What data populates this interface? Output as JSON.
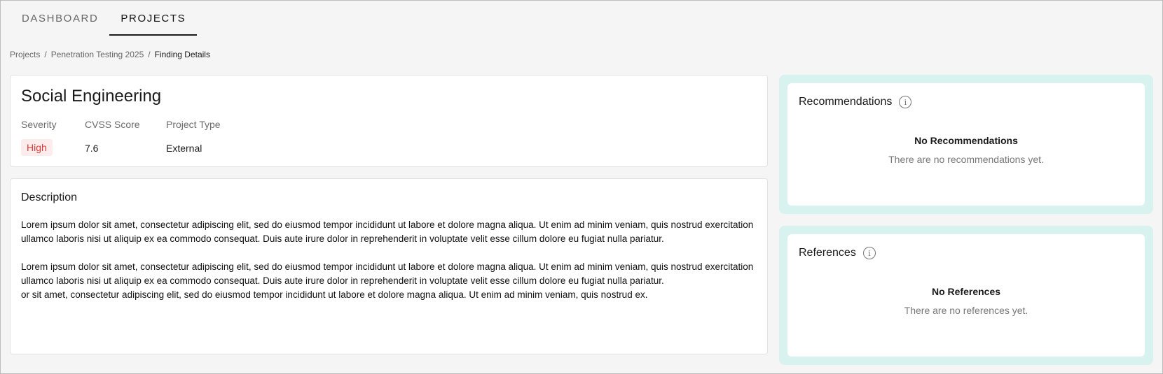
{
  "tabs": [
    {
      "label": "DASHBOARD",
      "active": false
    },
    {
      "label": "PROJECTS",
      "active": true
    }
  ],
  "breadcrumb": {
    "items": [
      "Projects",
      "Penetration Testing 2025"
    ],
    "current": "Finding Details",
    "separator": "/"
  },
  "finding": {
    "title": "Social Engineering",
    "severity_label": "Severity",
    "severity_value": "High",
    "cvss_label": "CVSS Score",
    "cvss_value": "7.6",
    "project_type_label": "Project Type",
    "project_type_value": "External",
    "severity_color": "#d93b3b"
  },
  "description": {
    "title": "Description",
    "paragraphs": [
      "Lorem ipsum dolor sit amet, consectetur adipiscing elit, sed do eiusmod tempor incididunt ut labore et dolore magna aliqua. Ut enim ad minim veniam, quis nostrud exercitation ullamco laboris nisi ut aliquip ex ea commodo consequat. Duis aute irure dolor in reprehenderit in voluptate velit esse cillum dolore eu fugiat nulla pariatur.",
      "Lorem ipsum dolor sit amet, consectetur adipiscing elit, sed do eiusmod tempor incididunt ut labore et dolore magna aliqua. Ut enim ad minim veniam, quis nostrud exercitation ullamco laboris nisi ut aliquip ex ea commodo consequat. Duis aute irure dolor in reprehenderit in voluptate velit esse cillum dolore eu fugiat nulla pariatur.",
      "or sit amet, consectetur adipiscing elit, sed do eiusmod tempor incididunt ut labore et dolore magna aliqua. Ut enim ad minim veniam, quis nostrud ex."
    ]
  },
  "recommendations": {
    "title": "Recommendations",
    "empty_title": "No Recommendations",
    "empty_text": "There are no recommendations yet."
  },
  "references": {
    "title": "References",
    "empty_title": "No References",
    "empty_text": "There are no references yet."
  },
  "colors": {
    "accent_panel": "#d7f2ef",
    "severity_bg": "#fdecec"
  },
  "icons": {
    "info": "info-icon"
  }
}
